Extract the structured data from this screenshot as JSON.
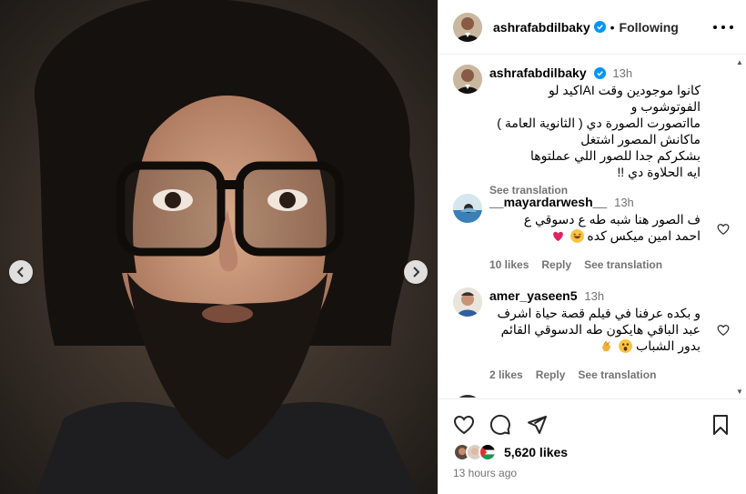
{
  "post": {
    "author": "ashrafabdilbaky",
    "follow_status": "Following",
    "separator": "•"
  },
  "caption": {
    "username": "ashrafabdilbaky",
    "time": "13h",
    "lines": [
      "كانوا موجودين وقت AIاكيد لو الفوتوشوب و",
      "مااتصورت الصورة دي ( الثانوية العامة )",
      "ماكانش المصور اشتغل",
      "بشكركم جدا للصور اللي عملتوها",
      "ايه الحلاوة دي !!"
    ],
    "see_translation": "See translation"
  },
  "comments": [
    {
      "username": "__mayardarwesh__",
      "time": "13h",
      "lines": [
        "ف الصور هنا شبه طه ع دسوقي ع",
        "احمد امين ميكس كده"
      ],
      "likes": "10 likes",
      "reply": "Reply",
      "see_translation": "See translation",
      "emojis": [
        "laughing-emoji",
        "red-heart-emoji"
      ]
    },
    {
      "username": "amer_yaseen5",
      "time": "13h",
      "lines": [
        "و بكده عرفنا في فيلم قصة حياة اشرف",
        "عبد الباقي هايكون طه الدسوقي القائم",
        "بدور الشباب"
      ],
      "likes": "2 likes",
      "reply": "Reply",
      "see_translation": "See translation",
      "emojis": [
        "astonished-emoji",
        "clapping-hands-emoji"
      ]
    }
  ],
  "footer": {
    "likes": "5,620 likes",
    "posted": "13 hours ago"
  },
  "colors": {
    "verified_blue": "#0095f6",
    "secondary_text": "#737373",
    "border": "#efefef",
    "heart_red": "#e0245e",
    "emoji_yellow": "#f7c43c"
  },
  "icons": [
    "verified-badge-icon",
    "more-options-icon",
    "heart-icon",
    "comment-icon",
    "share-icon",
    "bookmark-icon",
    "chevron-left-icon",
    "chevron-right-icon"
  ]
}
